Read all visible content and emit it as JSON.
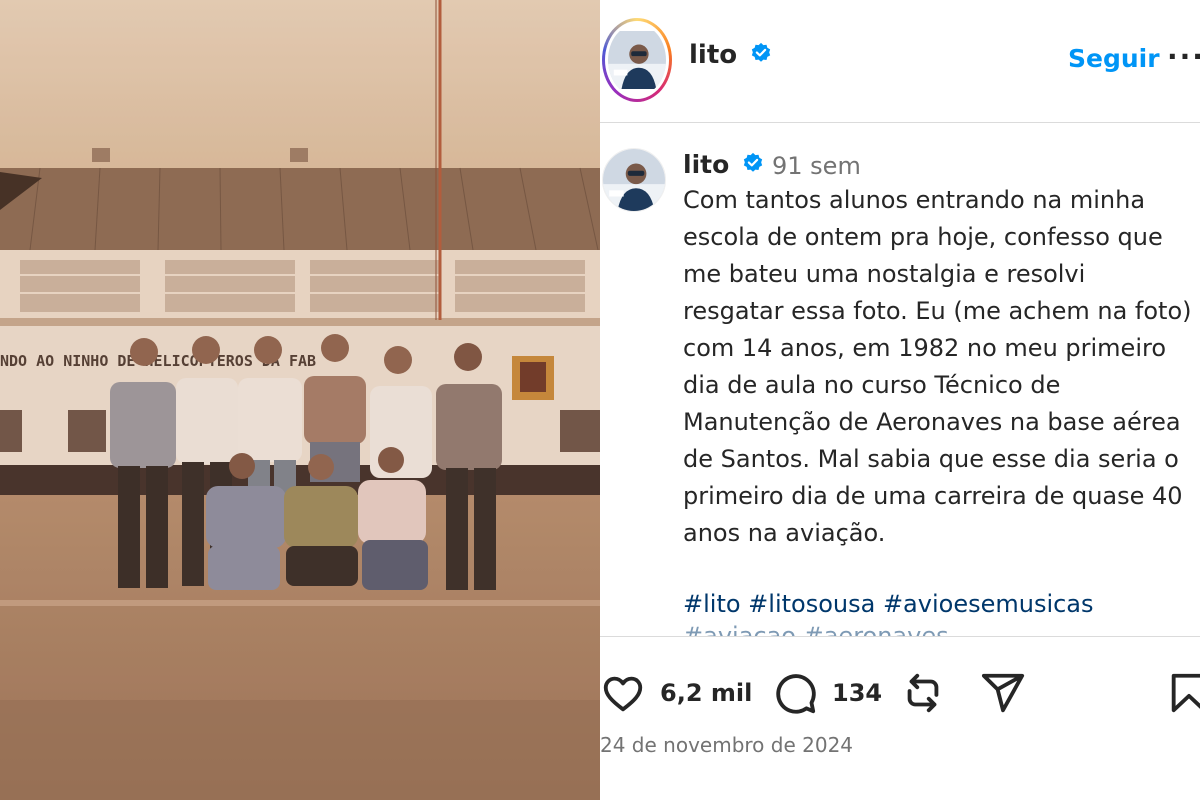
{
  "photo": {
    "alt": "Foto antiga de um grupo de jovens em frente a um hangar"
  },
  "photo_sign_text": "NDO AO NINHO DE HELICÓPTEROS DA FAB",
  "header": {
    "username": "lito",
    "follow_label": "Seguir",
    "more_label": "···"
  },
  "caption": {
    "username": "lito",
    "time": "91 sem",
    "text": "Com tantos alunos entrando na minha escola de ontem pra hoje, confesso que me bateu uma nostalgia e resolvi resgatar essa foto. Eu (me achem na foto) com 14 anos, em 1982 no meu primeiro dia de aula no curso Técnico de Manutenção de Aeronaves na base aérea de Santos. Mal sabia que esse dia seria o primeiro dia de uma carreira de quase 40 anos na aviação.",
    "hashtags": "#lito #litosousa #avioesemusicas",
    "hashtags_more": "#aviacao #aeronaves"
  },
  "actions": {
    "likes": "6,2 mil",
    "comments": "134",
    "date": "24 de novembro de 2024"
  },
  "colors": {
    "link_blue": "#0095f6",
    "hashtag_blue": "#00376b",
    "muted": "#737373",
    "verified": "#0095f6"
  }
}
